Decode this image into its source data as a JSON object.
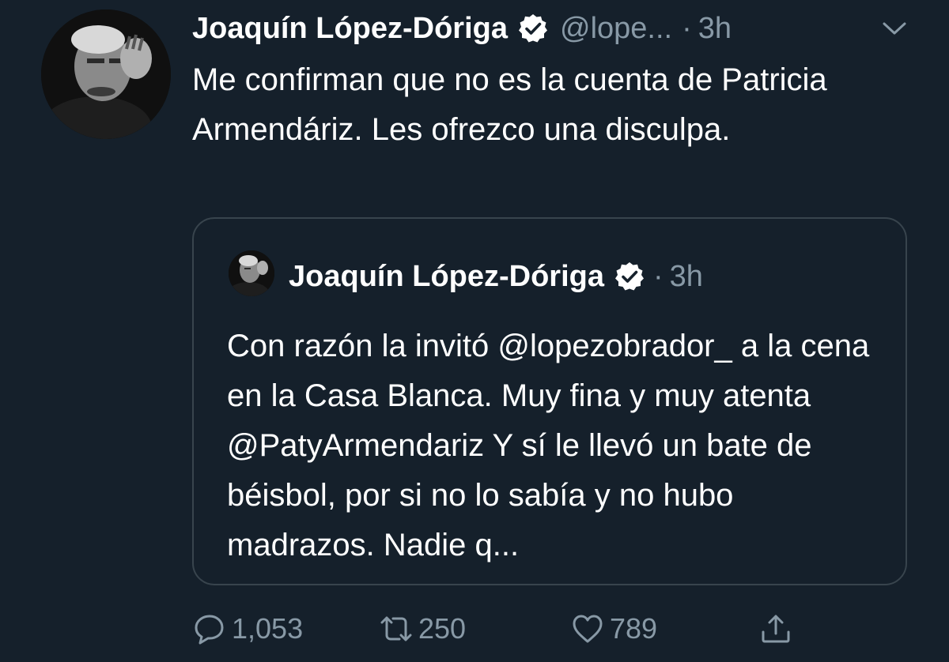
{
  "tweet": {
    "author": {
      "display_name": "Joaquín López-Dóriga",
      "handle": "@lope...",
      "verified": true
    },
    "separator": "·",
    "time": "3h",
    "text": "Me confirman que no es la cuenta de Patricia Armendáriz. Les ofrezco una disculpa.",
    "menu_icon": "chevron-down-icon"
  },
  "quoted_tweet": {
    "author": {
      "display_name": "Joaquín López-Dóriga",
      "verified": true
    },
    "separator": "·",
    "time": "3h",
    "text": "Con razón la invitó @lopezobrador_ a la cena en la Casa Blanca. Muy fina y muy atenta @PatyArmendariz Y sí le llevó un bate de béisbol, por si no lo sabía y no hubo madrazos. Nadie q..."
  },
  "actions": {
    "reply": {
      "icon": "reply-icon",
      "count": "1,053"
    },
    "retweet": {
      "icon": "retweet-icon",
      "count": "250"
    },
    "like": {
      "icon": "heart-icon",
      "count": "789"
    },
    "share": {
      "icon": "share-icon"
    }
  },
  "colors": {
    "background": "#15202b",
    "text_primary": "#ffffff",
    "text_secondary": "#8899a6",
    "border": "#38444d"
  }
}
